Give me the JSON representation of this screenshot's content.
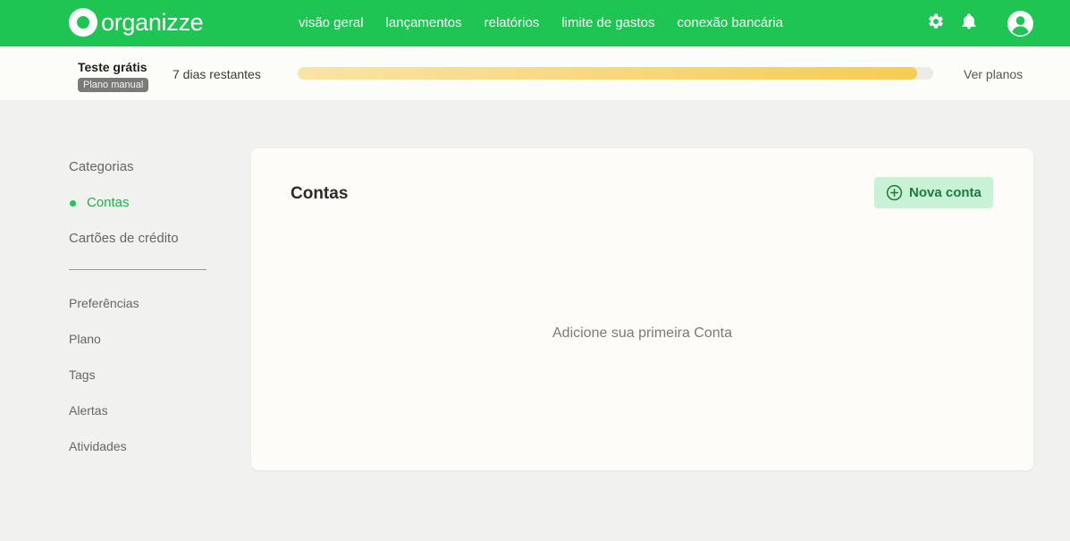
{
  "brand": {
    "name": "organizze",
    "accent": "#1fc552"
  },
  "nav": {
    "items": [
      "visão geral",
      "lançamentos",
      "relatórios",
      "limite de gastos",
      "conexão bancária"
    ]
  },
  "top_icons": [
    "gear-icon",
    "bell-icon",
    "user-avatar-icon"
  ],
  "trial": {
    "title": "Teste grátis",
    "badge": "Plano manual",
    "days_left": "7 dias restantes",
    "progress_fraction": 0.975,
    "see_plans": "Ver planos"
  },
  "sidebar": {
    "group1": [
      {
        "label": "Categorias",
        "active": false
      },
      {
        "label": "Contas",
        "active": true
      },
      {
        "label": "Cartões de crédito",
        "active": false
      }
    ],
    "group2": [
      "Preferências",
      "Plano",
      "Tags",
      "Alertas",
      "Atividades"
    ]
  },
  "main": {
    "title": "Contas",
    "new_button": "Nova conta",
    "empty_message": "Adicione sua primeira Conta"
  }
}
